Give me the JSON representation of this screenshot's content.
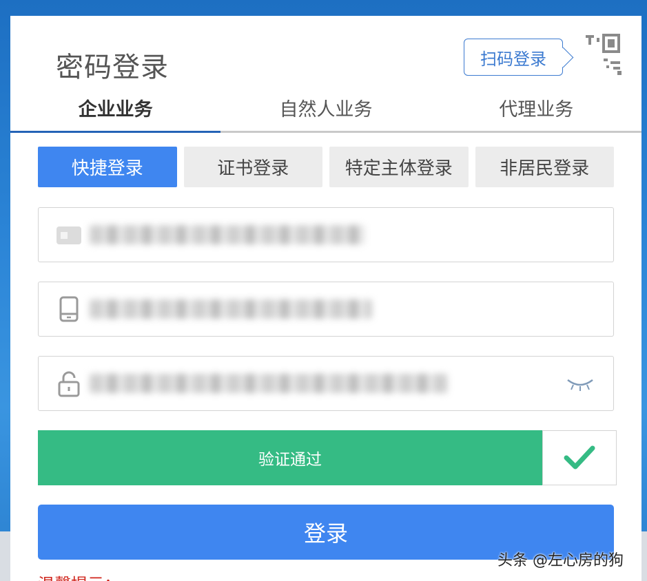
{
  "header": {
    "title": "密码登录",
    "scan_login_label": "扫码登录"
  },
  "biz_tabs": [
    {
      "label": "企业业务",
      "active": true
    },
    {
      "label": "自然人业务",
      "active": false
    },
    {
      "label": "代理业务",
      "active": false
    }
  ],
  "login_tabs": [
    {
      "label": "快捷登录",
      "active": true
    },
    {
      "label": "证书登录",
      "active": false
    },
    {
      "label": "特定主体登录",
      "active": false
    },
    {
      "label": "非居民登录",
      "active": false
    }
  ],
  "fields": {
    "company_id": {
      "icon": "id-card-icon",
      "value": ""
    },
    "phone": {
      "icon": "phone-icon",
      "value": ""
    },
    "password": {
      "icon": "lock-icon",
      "value": "",
      "toggle_icon": "eye-closed-icon"
    }
  },
  "verify": {
    "label": "验证通过",
    "status_icon": "check-icon",
    "color": "#35bb84"
  },
  "login_button": {
    "label": "登录",
    "color": "#3f86f0"
  },
  "tip": {
    "label": "温馨提示："
  },
  "watermark": {
    "text": "头条 @左心房的狗"
  }
}
